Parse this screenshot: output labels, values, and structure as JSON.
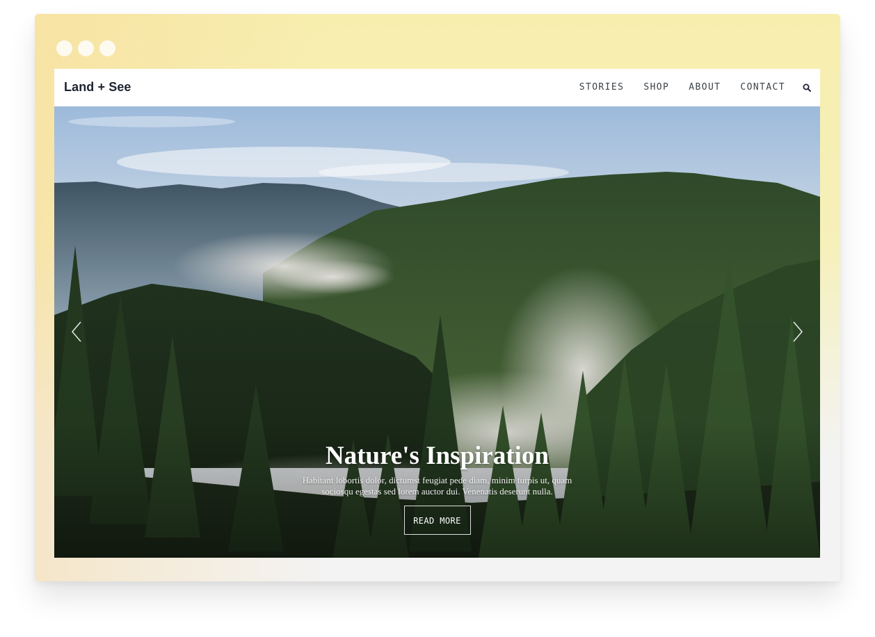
{
  "window": {
    "controls": [
      "dot",
      "dot",
      "dot"
    ]
  },
  "site": {
    "brand": "Land + See",
    "nav": [
      {
        "label": "STORIES"
      },
      {
        "label": "SHOP"
      },
      {
        "label": "ABOUT"
      },
      {
        "label": "CONTACT"
      }
    ],
    "search_icon": "search-icon"
  },
  "hero": {
    "title": "Nature's Inspiration",
    "text": "Habitant lobortis dolor, dictumst feugiat pede diam, minim turpis ut, quam sociosqu egestas sed lorem auctor dui. Venenatis deserunt nulla.",
    "button_label": "READ MORE",
    "prev_icon": "chevron-left-icon",
    "next_icon": "chevron-right-icon"
  },
  "colors": {
    "frame_top": "#f7eeae",
    "frame_bottom": "#f3f3f3",
    "nav_text": "#3c4248",
    "brand_text": "#1f2330"
  }
}
